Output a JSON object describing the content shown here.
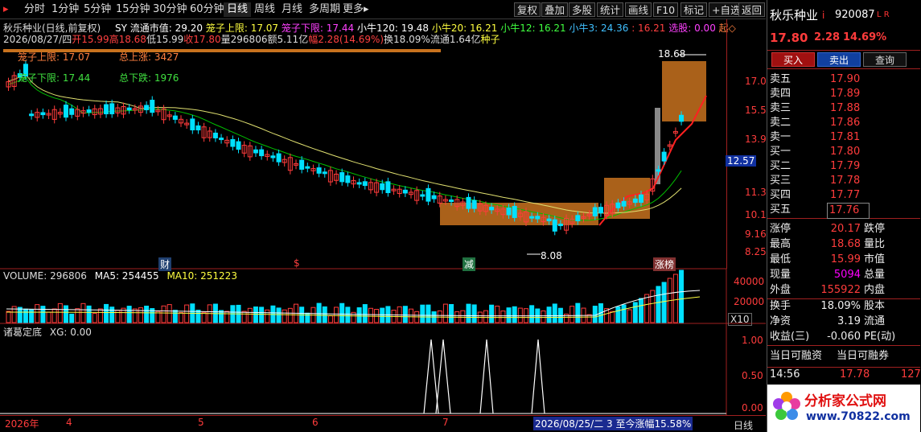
{
  "toolbar": {
    "tabs": [
      "分时",
      "1分钟",
      "5分钟",
      "15分钟",
      "30分钟",
      "60分钟",
      "日线",
      "周线",
      "月线",
      "多周期",
      "更多▸"
    ],
    "right": [
      "复权",
      "叠加",
      "多股",
      "统计",
      "画线",
      "F10",
      "标记",
      "+自选",
      "返回"
    ]
  },
  "stock": {
    "name": "秋乐种业",
    "code": "920087",
    "flag": "i",
    "tags": "L R",
    "price": "17.80",
    "change": "2.28",
    "pct": "14.69%"
  },
  "info": {
    "title": "秋乐种业(日线,前复权)",
    "sy": "SY",
    "mcap": "流通市值: 29.20",
    "cage_up": "笼子上限: 17.07",
    "cage_down": "笼子下限: 17.44",
    "ox120": "小牛120: 19.48",
    "ox20": "小牛20: 16.21",
    "ox12": "小牛12: 16.21",
    "ox3": "小牛3: 24.36",
    "sep": ": 16.21",
    "select": "选股: 0.00",
    "qi": "起◇",
    "date": "2026/08/27/四",
    "open": "开15.99",
    "high": "高18.68",
    "low": "低15.99",
    "close": "收17.80",
    "vol": "量296806",
    "amt": "额5.11亿",
    "amp": "幅2.28(14.69%)",
    "turn": "换18.09%",
    "float": "流通1.64亿",
    "seed": "种子"
  },
  "overlays": {
    "cage_up_label": "笼子上限: 17.07",
    "total_up": "总上涨: 3427",
    "cage_down_label": "笼子下限: 17.44",
    "total_down": "总下跌: 1976",
    "hi_mark": "18.68",
    "lo_mark": "8.08",
    "ev_cai": "财",
    "ev_s": "$",
    "ev_jian": "减",
    "ev_zt": "涨榜",
    "cursor_price": "12.57"
  },
  "price_axis": [
    "17.07",
    "15.52",
    "13.97",
    "12.57",
    "11.31",
    "10.18",
    "9.16",
    "8.25"
  ],
  "volume": {
    "title": "VOLUME: 296806",
    "ma5": "MA5: 254455",
    "ma10": "MA10: 251223",
    "axis": [
      "40000",
      "20000"
    ],
    "unit": "X10"
  },
  "indicator": {
    "title": "诸葛定底",
    "xg": "XG: 0.00",
    "axis": [
      "1.00",
      "0.50",
      "0.00"
    ]
  },
  "date_axis": {
    "labels": [
      "2026年",
      "4",
      "5",
      "6",
      "7"
    ],
    "note": "2026/08/25/二 3 至今涨幅15.58%",
    "period": "日线"
  },
  "quotes": {
    "sell": [
      {
        "label": "卖五",
        "price": "17.90"
      },
      {
        "label": "卖四",
        "price": "17.89"
      },
      {
        "label": "卖三",
        "price": "17.88"
      },
      {
        "label": "卖二",
        "price": "17.86"
      },
      {
        "label": "卖一",
        "price": "17.81"
      }
    ],
    "buy": [
      {
        "label": "买一",
        "price": "17.80"
      },
      {
        "label": "买二",
        "price": "17.79"
      },
      {
        "label": "买三",
        "price": "17.78"
      },
      {
        "label": "买四",
        "price": "17.77"
      },
      {
        "label": "买五",
        "price": "17.76"
      }
    ]
  },
  "buttons": {
    "buy": "买入",
    "sell": "卖出",
    "query": "查询"
  },
  "stats": [
    {
      "l": "涨停",
      "v": "20.17",
      "r": "跌停"
    },
    {
      "l": "最高",
      "v": "18.68",
      "r": "量比"
    },
    {
      "l": "最低",
      "v": "15.99",
      "r": "市值"
    },
    {
      "l": "现量",
      "v": "5094",
      "r": "总量"
    },
    {
      "l": "外盘",
      "v": "155922",
      "r": "内盘"
    }
  ],
  "stats2": [
    {
      "l": "换手",
      "v": "18.09%",
      "r": "股本"
    },
    {
      "l": "净资",
      "v": "3.19",
      "r": "流通"
    },
    {
      "l": "收益(三)",
      "v": "-0.060",
      "r": "PE(动)"
    }
  ],
  "margin": {
    "l": "当日可融资",
    "r": "当日可融券"
  },
  "tick": {
    "time": "14:56",
    "price": "17.78",
    "vol": "127"
  },
  "logo": {
    "text": "分析家公式网",
    "url": "www.70822.com"
  },
  "colors": {
    "up": "#ff3c3c",
    "down": "#00e0ff",
    "ma": "#00c000",
    "ma2": "#e0e070",
    "box": "#c8721e"
  }
}
